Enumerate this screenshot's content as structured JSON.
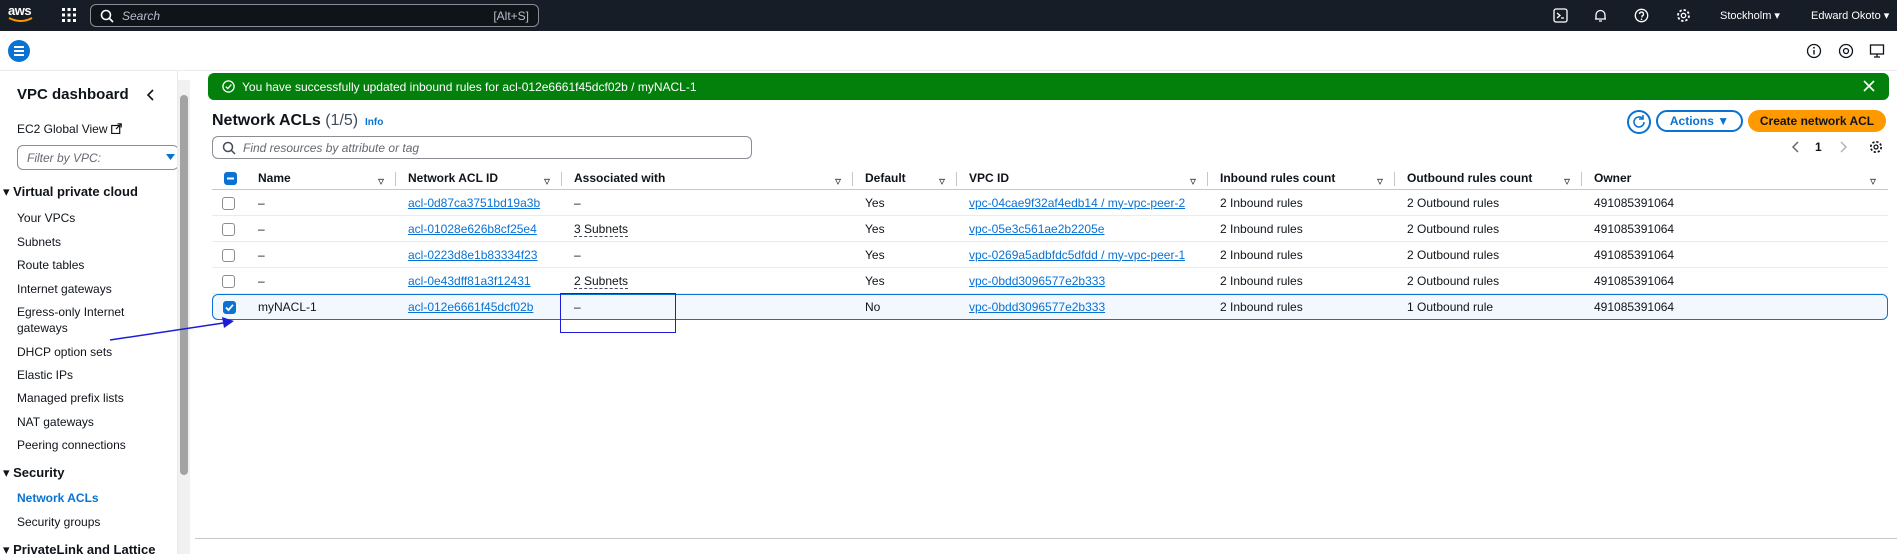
{
  "topnav": {
    "logo_text": "aws",
    "search_placeholder": "Search",
    "search_shortcut": "[Alt+S]",
    "region": "Stockholm",
    "user": "Edward Okoto"
  },
  "sidebar": {
    "title": "VPC dashboard",
    "ec2_global_view": "EC2 Global View",
    "filter_placeholder": "Filter by VPC:",
    "section_vpc": "Virtual private cloud",
    "vpc_items": [
      "Your VPCs",
      "Subnets",
      "Route tables",
      "Internet gateways",
      "Egress-only Internet",
      "gateways",
      "DHCP option sets",
      "Elastic IPs",
      "Managed prefix lists",
      "NAT gateways",
      "Peering connections"
    ],
    "section_security": "Security",
    "security_items": [
      "Network ACLs",
      "Security groups"
    ],
    "section_privatelink": "PrivateLink and Lattice"
  },
  "flash": {
    "message": "You have successfully updated inbound rules for acl-012e6661f45dcf02b / myNACL-1",
    "color": "#037f0c"
  },
  "header": {
    "title": "Network ACLs",
    "count": "(1/5)",
    "info": "Info",
    "actions_label": "Actions",
    "create_label": "Create network ACL",
    "find_placeholder": "Find resources by attribute or tag",
    "page": "1"
  },
  "table": {
    "columns": [
      "Name",
      "Network ACL ID",
      "Associated with",
      "Default",
      "VPC ID",
      "Inbound rules count",
      "Outbound rules count",
      "Owner"
    ],
    "rows": [
      {
        "name": "–",
        "acl_id": "acl-0d87ca3751bd19a3b",
        "assoc": "–",
        "default": "Yes",
        "vpc": "vpc-04cae9f32af4edb14 / my-vpc-peer-2",
        "inbound": "2 Inbound rules",
        "outbound": "2 Outbound rules",
        "owner": "491085391064",
        "selected": false
      },
      {
        "name": "–",
        "acl_id": "acl-01028e626b8cf25e4",
        "assoc": "3 Subnets",
        "default": "Yes",
        "vpc": "vpc-05e3c561ae2b2205e",
        "inbound": "2 Inbound rules",
        "outbound": "2 Outbound rules",
        "owner": "491085391064",
        "selected": false
      },
      {
        "name": "–",
        "acl_id": "acl-0223d8e1b83334f23",
        "assoc": "–",
        "default": "Yes",
        "vpc": "vpc-0269a5adbfdc5dfdd / my-vpc-peer-1",
        "inbound": "2 Inbound rules",
        "outbound": "2 Outbound rules",
        "owner": "491085391064",
        "selected": false
      },
      {
        "name": "–",
        "acl_id": "acl-0e43dff81a3f12431",
        "assoc": "2 Subnets",
        "default": "Yes",
        "vpc": "vpc-0bdd3096577e2b333",
        "inbound": "2 Inbound rules",
        "outbound": "2 Outbound rules",
        "owner": "491085391064",
        "selected": false
      },
      {
        "name": "myNACL-1",
        "acl_id": "acl-012e6661f45dcf02b",
        "assoc": "–",
        "default": "No",
        "vpc": "vpc-0bdd3096577e2b333",
        "inbound": "2 Inbound rules",
        "outbound": "1 Outbound rule",
        "owner": "491085391064",
        "selected": true
      }
    ]
  },
  "colors": {
    "accent": "#0972d3",
    "primary_button": "#ff9900",
    "topnav": "#161d26",
    "annotation": "#1d1dd8"
  }
}
